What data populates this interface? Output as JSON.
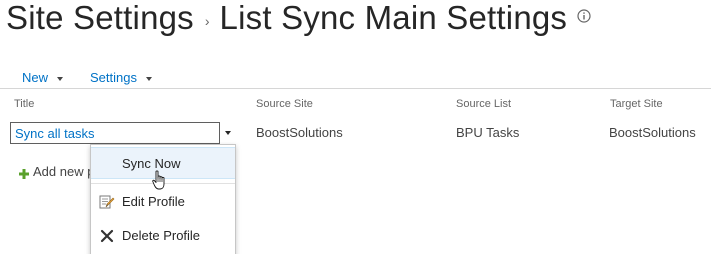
{
  "header": {
    "breadcrumb_parent": "Site Settings",
    "breadcrumb_separator": "›",
    "page_title": "List Sync Main Settings",
    "info_icon": "info-icon"
  },
  "toolbar": {
    "new_label": "New",
    "settings_label": "Settings"
  },
  "table": {
    "columns": [
      "Title",
      "Source Site",
      "Source List",
      "Target Site"
    ],
    "rows": [
      {
        "title": "Sync all tasks",
        "source_site": "BoostSolutions",
        "source_list": "BPU Tasks",
        "target_site": "BoostSolutions"
      }
    ]
  },
  "add_new": {
    "label": "Add new p",
    "icon": "plus-icon"
  },
  "context_menu": {
    "items": [
      {
        "label": "Sync Now",
        "icon": "",
        "highlighted": true
      },
      {
        "label": "Edit Profile",
        "icon": "edit-icon"
      },
      {
        "label": "Delete Profile",
        "icon": "delete-icon"
      }
    ]
  },
  "colors": {
    "link": "#0072c6",
    "title_text": "#262626",
    "menu_highlight": "#ebf3fb",
    "add_icon_green": "#5aa02c"
  }
}
